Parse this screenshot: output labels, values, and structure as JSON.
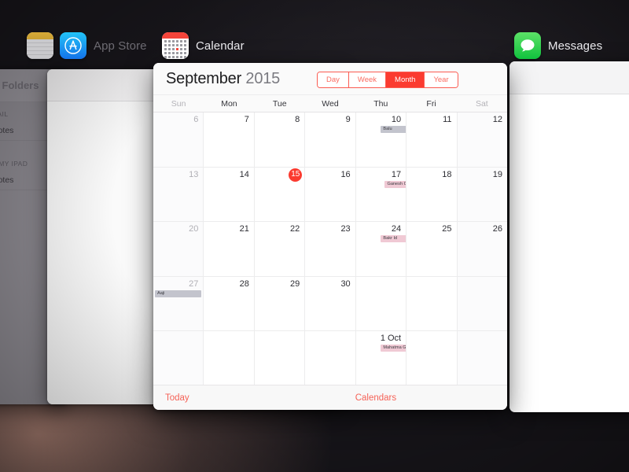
{
  "screen": {
    "name": "ios-app-switcher",
    "background_colors": [
      "#2e2b31",
      "#b08476",
      "#141216"
    ]
  },
  "apps": [
    {
      "id": "notes",
      "label": "",
      "icon": "notes-icon"
    },
    {
      "id": "appstore",
      "label": "App Store",
      "icon": "app-store-icon"
    },
    {
      "id": "calendar",
      "label": "Calendar",
      "icon": "calendar-icon"
    },
    {
      "id": "messages",
      "label": "Messages",
      "icon": "messages-icon"
    }
  ],
  "notes_card": {
    "sidebar_title": "Folders",
    "groups": [
      {
        "header": "GMAIL",
        "rows": [
          "Notes"
        ]
      },
      {
        "header": "ON MY IPAD",
        "rows": [
          "Notes"
        ]
      }
    ]
  },
  "calendar_card": {
    "month": "September",
    "year": "2015",
    "view_options": [
      "Day",
      "Week",
      "Month",
      "Year"
    ],
    "selected_view": "Month",
    "accent_color": "#fb3b30",
    "day_headers": [
      "Sun",
      "Mon",
      "Tue",
      "Wed",
      "Thu",
      "Fri",
      "Sat"
    ],
    "weeks": [
      [
        {
          "day": "6",
          "muted": true,
          "weekend": true
        },
        {
          "day": "7"
        },
        {
          "day": "8"
        },
        {
          "day": "9"
        },
        {
          "day": "10",
          "events": [
            {
              "title": "Balu",
              "color": "gray",
              "bleed": true
            }
          ]
        },
        {
          "day": "11"
        },
        {
          "day": "12",
          "weekend": true
        }
      ],
      [
        {
          "day": "13",
          "muted": true,
          "weekend": true
        },
        {
          "day": "14"
        },
        {
          "day": "15",
          "today": true
        },
        {
          "day": "16"
        },
        {
          "day": "17",
          "events": [
            {
              "title": "Ganesh Chaturthi/Vin…",
              "color": "pink",
              "wide": true
            }
          ]
        },
        {
          "day": "18"
        },
        {
          "day": "19",
          "weekend": true
        }
      ],
      [
        {
          "day": "20",
          "muted": true,
          "weekend": true
        },
        {
          "day": "21"
        },
        {
          "day": "22"
        },
        {
          "day": "23"
        },
        {
          "day": "24",
          "events": [
            {
              "title": "Bakr Id",
              "color": "pink",
              "bleed": true
            }
          ]
        },
        {
          "day": "25"
        },
        {
          "day": "26",
          "weekend": true
        }
      ],
      [
        {
          "day": "27",
          "muted": true,
          "weekend": true,
          "events": [
            {
              "title": "Aaji",
              "color": "gray",
              "full": true
            }
          ]
        },
        {
          "day": "28"
        },
        {
          "day": "29"
        },
        {
          "day": "30"
        },
        {
          "day": ""
        },
        {
          "day": ""
        },
        {
          "day": "",
          "weekend": true
        }
      ],
      [
        {
          "day": "",
          "weekend": true
        },
        {
          "day": ""
        },
        {
          "day": ""
        },
        {
          "day": ""
        },
        {
          "day": "1 Oct",
          "nextmonth": true,
          "events": [
            {
              "title": "Mahatma Gandhi Ja…",
              "color": "pink",
              "bleed": true
            }
          ]
        },
        {
          "day": ""
        },
        {
          "day": "",
          "weekend": true
        }
      ]
    ],
    "toolbar": {
      "today_label": "Today",
      "calendars_label": "Calendars"
    }
  },
  "messages_card": {
    "nav_title": ""
  }
}
